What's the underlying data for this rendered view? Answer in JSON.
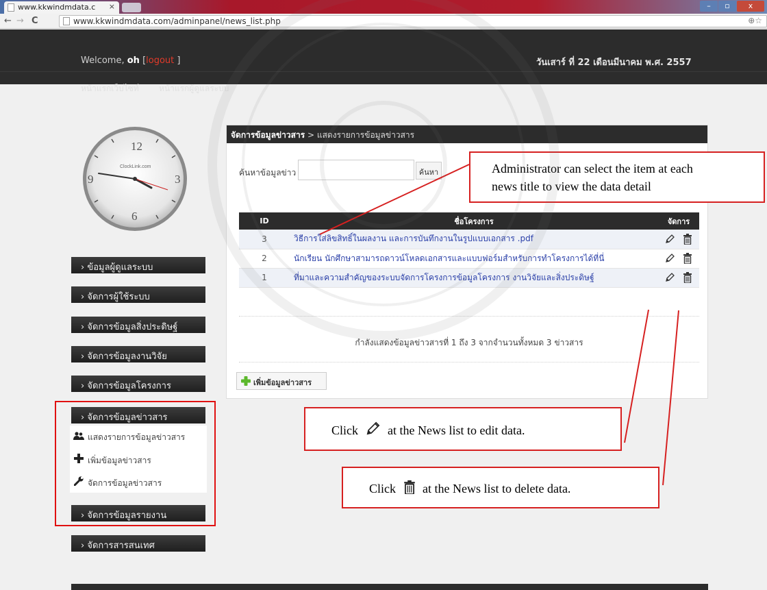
{
  "browser": {
    "tab_title": "www.kkwindmdata.c",
    "tab_close": "×",
    "url": "www.kkwindmdata.com/adminpanel/news_list.php",
    "back": "←",
    "forward": "→",
    "reload": "C",
    "zoom_star": "⊕☆",
    "minimize": "–",
    "maximize": "▫",
    "close": "x"
  },
  "header": {
    "welcome_prefix": "Welcome,",
    "username": "oh",
    "logout_open": "[",
    "logout": "logout",
    "logout_close": "]",
    "date": "วันเสาร์ ที่ 22 เดือนมีนาคม พ.ศ. 2557",
    "nav": [
      "หน้าแรกเว็บไซท์",
      "หน้าแรกผู้ดูแลระบบ"
    ]
  },
  "clock": {
    "brand": "ClockLink.com",
    "numerals": [
      "12",
      "3",
      "6",
      "9"
    ]
  },
  "sidebar": {
    "items": [
      "› ข้อมูลผู้ดูแลระบบ",
      "› จัดการผู้ใช้ระบบ",
      "› จัดการข้อมูลสิ่งประดิษฐ์",
      "› จัดการข้อมูลงานวิจัย",
      "› จัดการข้อมูลโครงการ",
      "› จัดการข้อมูลข่าวสาร",
      "› จัดการข้อมูลรายงาน",
      "› จัดการสารสนเทศ"
    ],
    "submenu": [
      {
        "icon": "users-icon",
        "label": "แสดงรายการข้อมูลข่าวสาร"
      },
      {
        "icon": "plus-icon",
        "label": "เพิ่มข้อมูลข่าวสาร"
      },
      {
        "icon": "wrench-icon",
        "label": "จัดการข้อมูลข่าวสาร"
      }
    ]
  },
  "panel": {
    "breadcrumb_main": "จัดการข้อมูลข่าวสาร",
    "breadcrumb_sep": ">",
    "breadcrumb_sub": "แสดงรายการข้อมูลข่าวสาร",
    "search_label": "ค้นหาข้อมูลข่าว :",
    "search_value": "",
    "search_button": "ค้นหา",
    "table": {
      "headers": [
        "ID",
        "ชื่อโครงการ",
        "จัดการ"
      ],
      "rows": [
        {
          "id": "3",
          "title": "วิธีการใส่ลิขสิทธิ์ในผลงาน และการบันทึกงานในรูปแบบเอกสาร .pdf"
        },
        {
          "id": "2",
          "title": "นักเรียน นักศึกษาสามารถดาวน์โหลดเอกสารและแบบฟอร์มสำหรับการทำโครงการได้ที่นี่"
        },
        {
          "id": "1",
          "title": "ที่มาและความสำคัญของระบบจัดการโครงการข้อมูลโครงการ งานวิจัยและสิ่งประดิษฐ์"
        }
      ]
    },
    "summary": "กำลังแสดงข้อมูลข่าวสารที่ 1 ถึง 3 จากจำนวนทั้งหมด 3 ข่าวสาร",
    "add_button": "เพิ่มข้อมูลข่าวสาร"
  },
  "annotations": {
    "title_note_line1": "Administrator can select the item at each",
    "title_note_line2": "news title to view the data detail",
    "edit_note_pre": "Click",
    "edit_note_post": "at the News list to edit data.",
    "delete_note_pre": "Click",
    "delete_note_post": "at the News list to delete data."
  },
  "colors": {
    "header_bg": "#2c2c2c",
    "annotation_red": "#d62020",
    "link_blue": "#2a3fa8",
    "logout_red": "#e23a2a"
  }
}
